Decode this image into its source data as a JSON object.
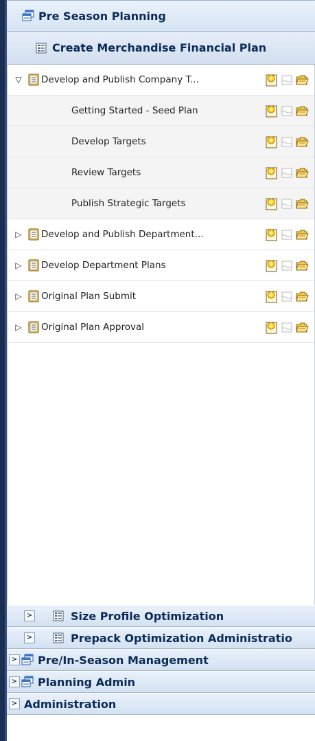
{
  "header": {
    "title": "Pre Season Planning",
    "icon": "windows-stack-icon"
  },
  "subheader": {
    "title": "Create Merchandise Financial Plan",
    "icon": "list-doc-icon"
  },
  "tasks": [
    {
      "label": "Develop and Publish Company T...",
      "level": 0,
      "expanded": true
    },
    {
      "label": "Getting Started - Seed Plan",
      "level": 1
    },
    {
      "label": "Develop Targets",
      "level": 1
    },
    {
      "label": "Review Targets",
      "level": 1
    },
    {
      "label": "Publish Strategic Targets",
      "level": 1
    },
    {
      "label": "Develop and Publish Department...",
      "level": 0,
      "expanded": false
    },
    {
      "label": "Develop Department Plans",
      "level": 0,
      "expanded": false
    },
    {
      "label": "Original Plan Submit",
      "level": 0,
      "expanded": false
    },
    {
      "label": "Original Plan Approval",
      "level": 0,
      "expanded": false
    }
  ],
  "row_action_icons": [
    "new-document-icon",
    "view-document-icon",
    "open-folder-icon"
  ],
  "accordion": [
    {
      "title": "Size Profile Optimization",
      "level": "sub",
      "icon": "list-doc-icon",
      "chevron": ">"
    },
    {
      "title": "Prepack Optimization Administratio",
      "level": "sub",
      "icon": "list-doc-icon",
      "chevron": ">"
    },
    {
      "title": "Pre/In-Season Management",
      "level": "top",
      "icon": "windows-stack-icon",
      "chevron": ">"
    },
    {
      "title": "Planning Admin",
      "level": "top",
      "icon": "windows-stack-icon",
      "chevron": ">"
    },
    {
      "title": "Administration",
      "level": "top",
      "icon": "",
      "chevron": ">"
    }
  ],
  "colors": {
    "header_text": "#0b2a55",
    "rail": "#1c2e52",
    "child_row_bg": "#f4f4f4"
  }
}
